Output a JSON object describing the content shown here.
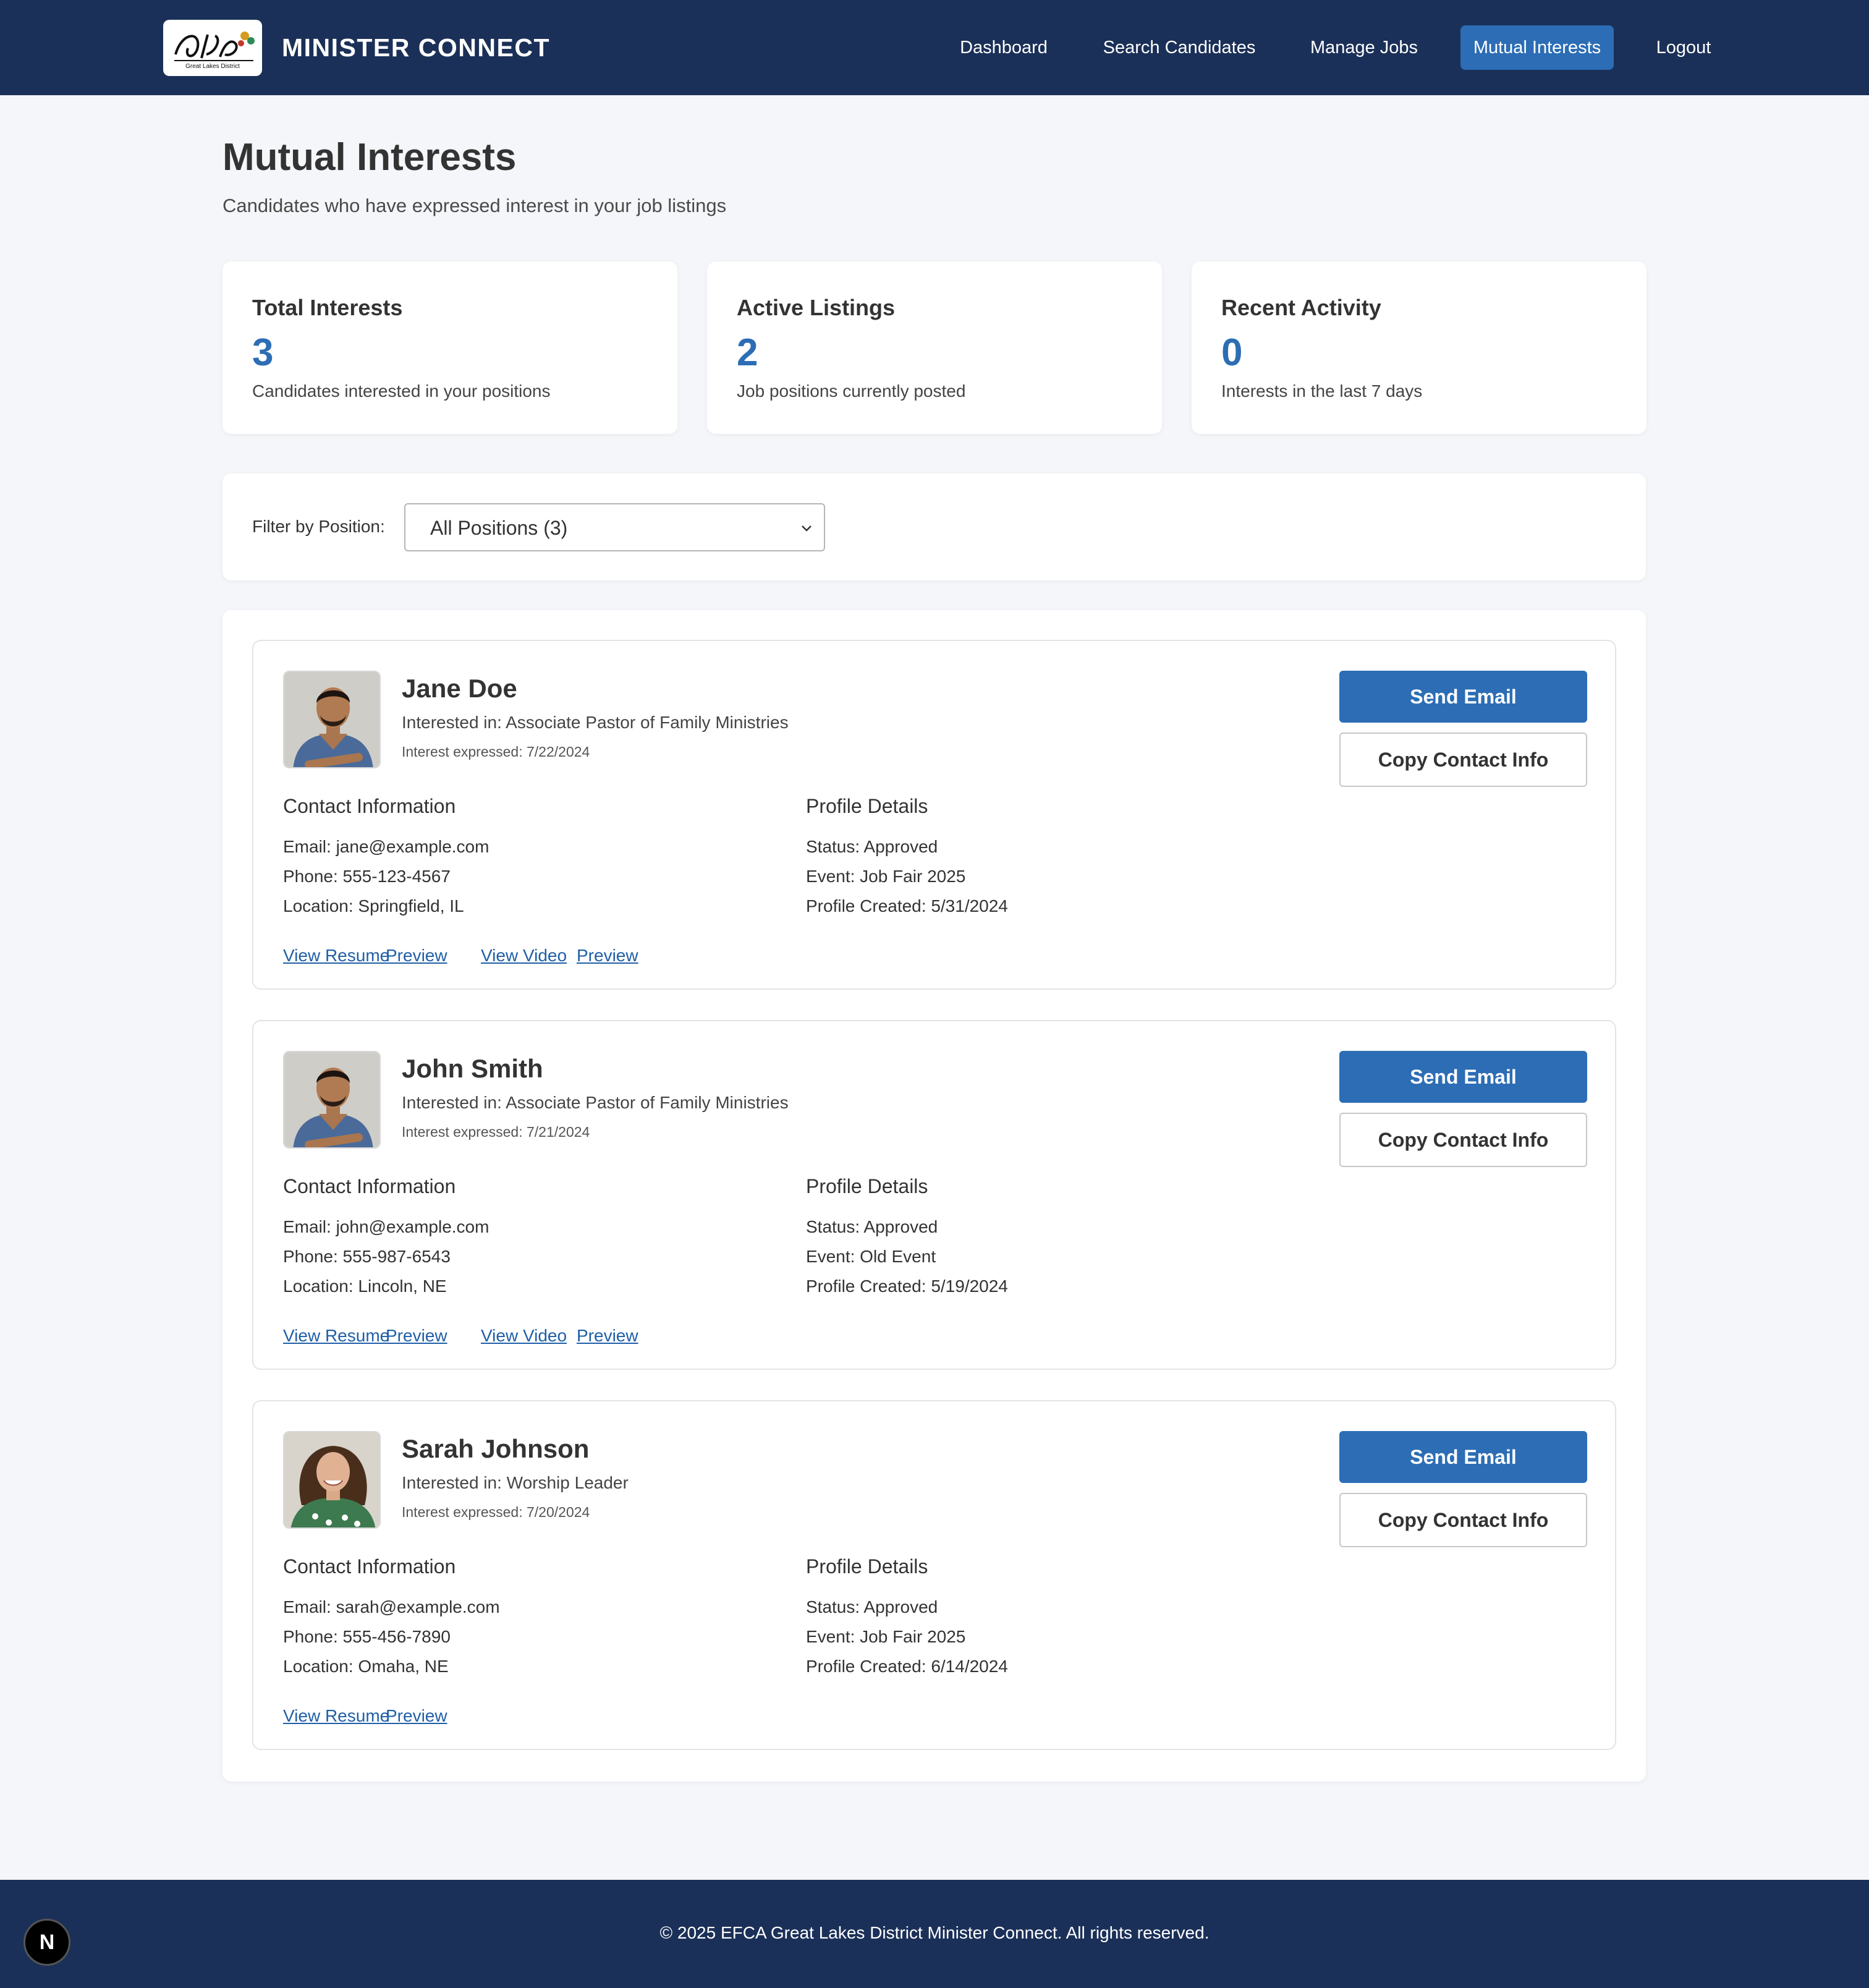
{
  "header": {
    "brand": "MINISTER CONNECT",
    "logo_text": "GLD",
    "logo_subtext": "Great Lakes District",
    "nav": [
      "Dashboard",
      "Search Candidates",
      "Manage Jobs",
      "Mutual Interests",
      "Logout"
    ],
    "active_nav": "Mutual Interests"
  },
  "page": {
    "title": "Mutual Interests",
    "subtitle": "Candidates who have expressed interest in your job listings"
  },
  "stats": [
    {
      "title": "Total Interests",
      "value": "3",
      "desc": "Candidates interested in your positions"
    },
    {
      "title": "Active Listings",
      "value": "2",
      "desc": "Job positions currently posted"
    },
    {
      "title": "Recent Activity",
      "value": "0",
      "desc": "Interests in the last 7 days"
    }
  ],
  "filter": {
    "label": "Filter by Position:",
    "selected": "All Positions (3)"
  },
  "candidates": [
    {
      "name": "Jane Doe",
      "position": "Interested in: Associate Pastor of Family Ministries",
      "date": "Interest expressed: 7/22/2024",
      "contact_heading": "Contact Information",
      "email": "Email: jane@example.com",
      "phone": "Phone: 555-123-4567",
      "location": "Location: Springfield, IL",
      "profile_heading": "Profile Details",
      "status": "Status: Approved",
      "event": "Event: Job Fair 2025",
      "created": "Profile Created: 5/31/2024",
      "resume_link": "View Resume",
      "resume_preview": "Preview",
      "video_link": "View Video",
      "video_preview": "Preview",
      "send_email": "Send Email",
      "copy_contact": "Copy Contact Info",
      "avatar": "man-avatar"
    },
    {
      "name": "John Smith",
      "position": "Interested in: Associate Pastor of Family Ministries",
      "date": "Interest expressed: 7/21/2024",
      "contact_heading": "Contact Information",
      "email": "Email: john@example.com",
      "phone": "Phone: 555-987-6543",
      "location": "Location: Lincoln, NE",
      "profile_heading": "Profile Details",
      "status": "Status: Approved",
      "event": "Event: Old Event",
      "created": "Profile Created: 5/19/2024",
      "resume_link": "View Resume",
      "resume_preview": "Preview",
      "video_link": "View Video",
      "video_preview": "Preview",
      "send_email": "Send Email",
      "copy_contact": "Copy Contact Info",
      "avatar": "man-avatar"
    },
    {
      "name": "Sarah Johnson",
      "position": "Interested in: Worship Leader",
      "date": "Interest expressed: 7/20/2024",
      "contact_heading": "Contact Information",
      "email": "Email: sarah@example.com",
      "phone": "Phone: 555-456-7890",
      "location": "Location: Omaha, NE",
      "profile_heading": "Profile Details",
      "status": "Status: Approved",
      "event": "Event: Job Fair 2025",
      "created": "Profile Created: 6/14/2024",
      "resume_link": "View Resume",
      "resume_preview": "Preview",
      "send_email": "Send Email",
      "copy_contact": "Copy Contact Info",
      "avatar": "woman-avatar"
    }
  ],
  "footer": {
    "text": "© 2025 EFCA Great Lakes District Minister Connect. All rights reserved.",
    "badge": "N"
  },
  "colors": {
    "header_bg": "#1b3058",
    "accent": "#2c6db5",
    "page_bg": "#f4f6f9",
    "link": "#1f5fa8"
  }
}
